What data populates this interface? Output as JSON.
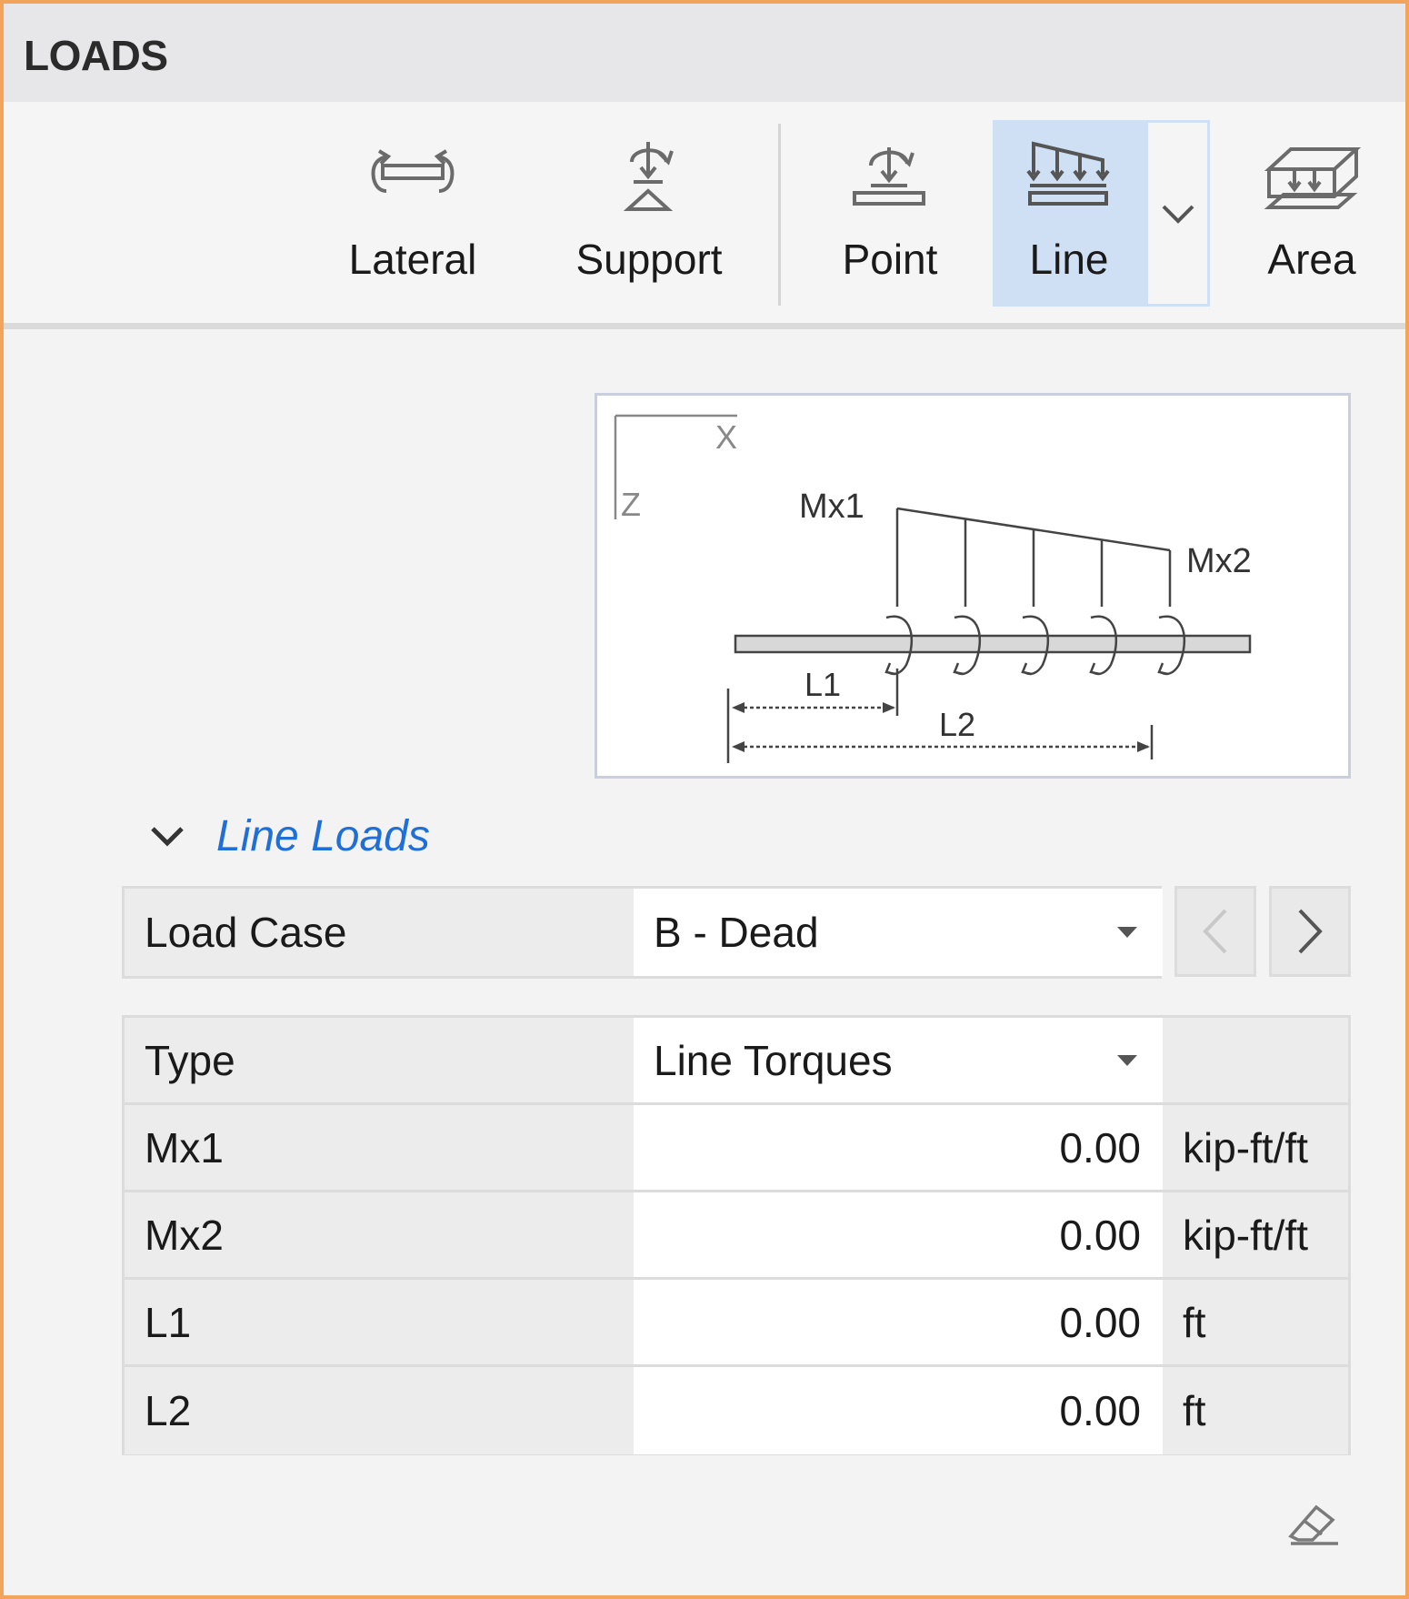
{
  "panel": {
    "title": "LOADS",
    "border_color": "#f2a35c"
  },
  "ribbon": {
    "buttons": [
      {
        "label": "Lateral",
        "icon": "lateral-load-icon"
      },
      {
        "label": "Support",
        "icon": "support-load-icon"
      },
      {
        "label": "Point",
        "icon": "point-load-icon"
      },
      {
        "label": "Line",
        "icon": "line-load-icon",
        "selected": true
      },
      {
        "label": "Area",
        "icon": "area-load-icon"
      }
    ],
    "selected_color": "#cfe0f4"
  },
  "diagram": {
    "axis_x": "X",
    "axis_z": "Z",
    "mx1": "Mx1",
    "mx2": "Mx2",
    "l1": "L1",
    "l2": "L2"
  },
  "section": {
    "title": "Line Loads",
    "title_color": "#1f6fd6"
  },
  "load_case": {
    "label": "Load Case",
    "value": "B - Dead"
  },
  "properties": {
    "type": {
      "label": "Type",
      "value": "Line Torques"
    },
    "rows": [
      {
        "label": "Mx1",
        "value": "0.00",
        "unit": "kip-ft/ft"
      },
      {
        "label": "Mx2",
        "value": "0.00",
        "unit": "kip-ft/ft"
      },
      {
        "label": "L1",
        "value": "0.00",
        "unit": "ft"
      },
      {
        "label": "L2",
        "value": "0.00",
        "unit": "ft"
      }
    ]
  }
}
